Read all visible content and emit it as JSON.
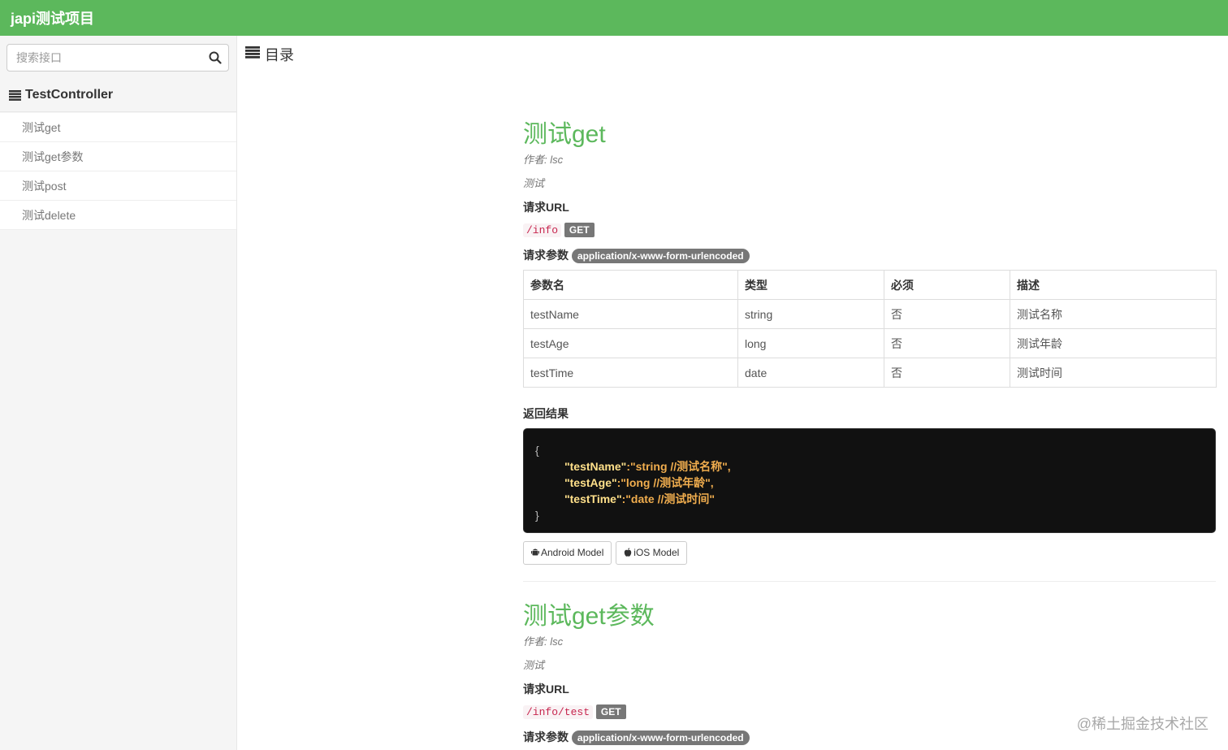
{
  "header": {
    "brand": "japi测试项目"
  },
  "sidebar": {
    "search_placeholder": "搜索接口",
    "group_title": "TestController",
    "items": [
      {
        "label": "测试get"
      },
      {
        "label": "测试get参数"
      },
      {
        "label": "测试post"
      },
      {
        "label": "测试delete"
      }
    ]
  },
  "toc": {
    "label": "目录"
  },
  "apis": [
    {
      "title": "测试get",
      "author": "作者: lsc",
      "description": "测试",
      "url_label": "请求URL",
      "url": "/info",
      "method": "GET",
      "params_label": "请求参数",
      "content_type": "application/x-www-form-urlencoded",
      "table": {
        "headers": [
          "参数名",
          "类型",
          "必须",
          "描述"
        ],
        "rows": [
          [
            "testName",
            "string",
            "否",
            "测试名称"
          ],
          [
            "testAge",
            "long",
            "否",
            "测试年龄"
          ],
          [
            "testTime",
            "date",
            "否",
            "测试时间"
          ]
        ]
      },
      "result_label": "返回结果",
      "result": {
        "open": "{",
        "lines": [
          {
            "key": "\"testName\"",
            "rest": ":\"string //测试名称\","
          },
          {
            "key": "\"testAge\"",
            "rest": ":\"long //测试年龄\","
          },
          {
            "key": "\"testTime\"",
            "rest": ":\"date //测试时间\""
          }
        ],
        "close": "}"
      },
      "buttons": {
        "android": "Android Model",
        "ios": "iOS Model"
      }
    },
    {
      "title": "测试get参数",
      "author": "作者: lsc",
      "description": "测试",
      "url_label": "请求URL",
      "url": "/info/test",
      "method": "GET",
      "params_label": "请求参数",
      "content_type": "application/x-www-form-urlencoded"
    }
  ],
  "watermark": "@稀土掘金技术社区",
  "icons": {
    "search": "search-icon",
    "list": "list-icon",
    "android": "android-icon",
    "apple": "apple-icon"
  },
  "colors": {
    "header": "#5cb85c",
    "title": "#5cb85c",
    "badge": "#777777",
    "code_bg": "#111111",
    "code_text": "#f0ad4e"
  }
}
